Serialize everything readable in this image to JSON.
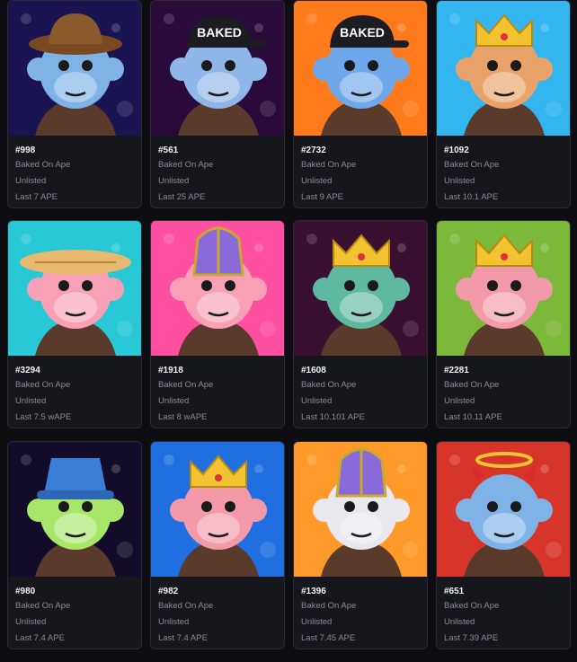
{
  "collection_label": "Baked On Ape",
  "status_label": "Unlisted",
  "items": [
    {
      "id": "#998",
      "collection": "Baked On Ape",
      "status": "Unlisted",
      "last": "Last 7 APE",
      "bg": "#1a1450",
      "skin": "#7fb2e6",
      "hat": "brown-cowboy-hat"
    },
    {
      "id": "#561",
      "collection": "Baked On Ape",
      "status": "Unlisted",
      "last": "Last 25 APE",
      "bg": "#2a0a3a",
      "skin": "#8fb6e8",
      "hat": "black-cap-baked"
    },
    {
      "id": "#2732",
      "collection": "Baked On Ape",
      "status": "Unlisted",
      "last": "Last 9 APE",
      "bg": "#ff7a1a",
      "skin": "#6fa8ea",
      "hat": "black-cap-baked"
    },
    {
      "id": "#1092",
      "collection": "Baked On Ape",
      "status": "Unlisted",
      "last": "Last 10.1 APE",
      "bg": "#33b6f0",
      "skin": "#e9a36a",
      "hat": "gold-crown"
    },
    {
      "id": "#3294",
      "collection": "Baked On Ape",
      "status": "Unlisted",
      "last": "Last 7.5 wAPE",
      "bg": "#28c8d6",
      "skin": "#f7a0b6",
      "hat": "straw-hat"
    },
    {
      "id": "#1918",
      "collection": "Baked On Ape",
      "status": "Unlisted",
      "last": "Last 8 wAPE",
      "bg": "#ff4fa0",
      "skin": "#f7a0b6",
      "hat": "purple-mitre"
    },
    {
      "id": "#1608",
      "collection": "Baked On Ape",
      "status": "Unlisted",
      "last": "Last 10.101 APE",
      "bg": "#3a1030",
      "skin": "#5fb8a0",
      "hat": "gold-crown"
    },
    {
      "id": "#2281",
      "collection": "Baked On Ape",
      "status": "Unlisted",
      "last": "Last 10.11 APE",
      "bg": "#7cb83a",
      "skin": "#f39aaa",
      "hat": "gold-crown"
    },
    {
      "id": "#980",
      "collection": "Baked On Ape",
      "status": "Unlisted",
      "last": "Last 7.4 APE",
      "bg": "#120c2a",
      "skin": "#a8e66a",
      "hat": "blue-bucket-hat"
    },
    {
      "id": "#982",
      "collection": "Baked On Ape",
      "status": "Unlisted",
      "last": "Last 7.4 APE",
      "bg": "#1f6fe0",
      "skin": "#f39aaa",
      "hat": "gold-crown"
    },
    {
      "id": "#1396",
      "collection": "Baked On Ape",
      "status": "Unlisted",
      "last": "Last 7.45 APE",
      "bg": "#ff9a2a",
      "skin": "#e8e8ee",
      "hat": "purple-mitre"
    },
    {
      "id": "#651",
      "collection": "Baked On Ape",
      "status": "Unlisted",
      "last": "Last 7.39 APE",
      "bg": "#d8352a",
      "skin": "#7fb2e6",
      "hat": "halo-horns"
    }
  ]
}
